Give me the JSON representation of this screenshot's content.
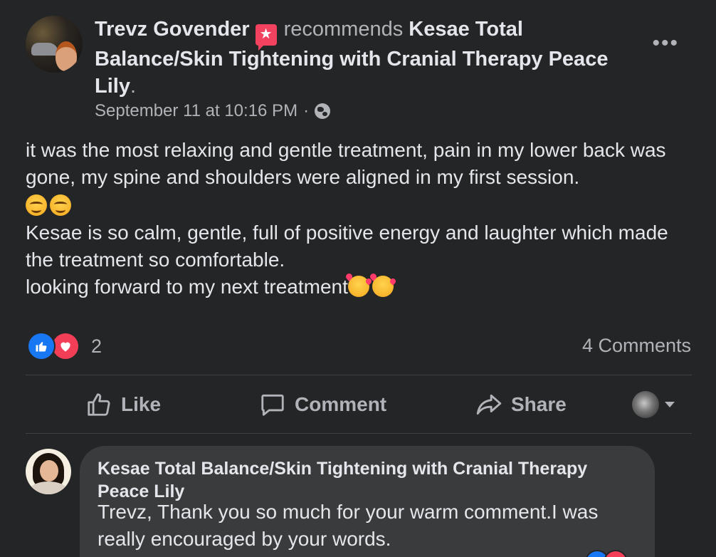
{
  "post": {
    "author": "Trevz Govender",
    "verb": "recommends",
    "page": "Kesae Total Balance/Skin Tightening with Cranial Therapy Peace Lily",
    "period": ".",
    "timestamp": "September 11 at 10:16 PM",
    "separator": "·",
    "more_label": "•••",
    "body": {
      "line1": "it was the most relaxing and gentle treatment, pain in my lower back was gone, my spine and shoulders were aligned in my first session.",
      "line2": "Kesae is so calm, gentle, full of positive energy and laughter which made the treatment so comfortable.",
      "line3": "looking forward to my next treatment"
    },
    "reaction_count": "2",
    "comments_label": "4 Comments"
  },
  "actions": {
    "like": "Like",
    "comment": "Comment",
    "share": "Share"
  },
  "comment": {
    "author": "Kesae Total Balance/Skin Tightening with Cranial Therapy Peace Lily",
    "text": "Trevz, Thank you so much for your warm comment.I was really encouraged by your words."
  },
  "icons": {
    "badge": "recommendation-star-icon",
    "privacy": "globe-icon",
    "reactions": [
      "like-reaction-icon",
      "love-reaction-icon"
    ]
  },
  "colors": {
    "background": "#242526",
    "bubble": "#3a3b3c",
    "primary_text": "#e4e6eb",
    "secondary_text": "#b0b3b8",
    "like_blue": "#1877f2",
    "love_red": "#f33e58",
    "badge_pink": "#f3425f"
  }
}
